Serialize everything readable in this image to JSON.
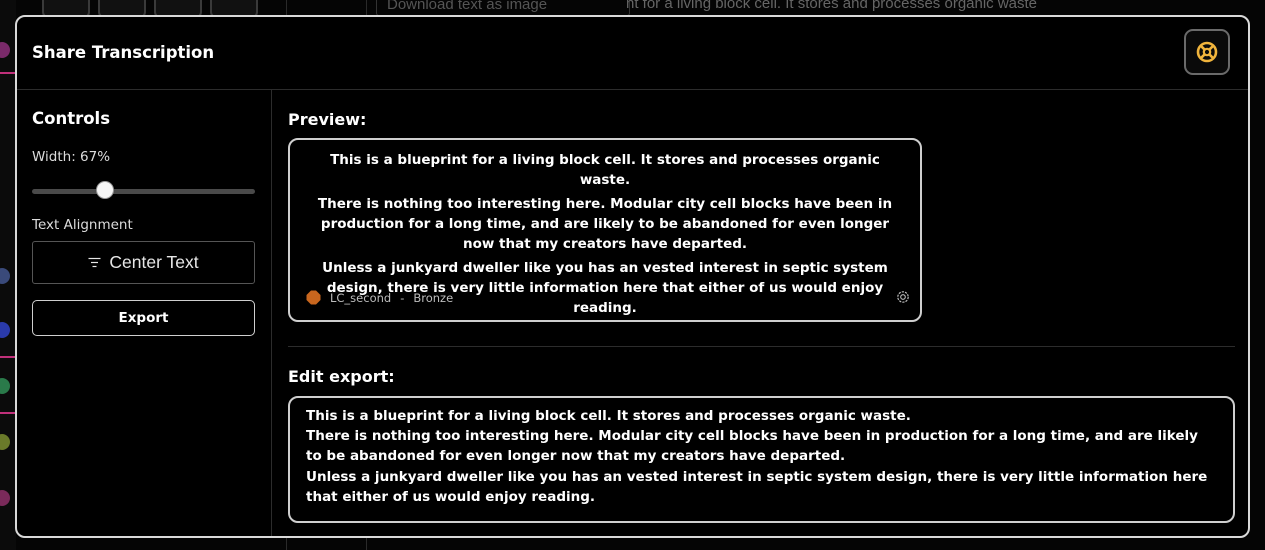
{
  "background": {
    "field_placeholder": "Download text as image",
    "text_snippet": "nt for a living block cell. It stores and processes organic waste"
  },
  "modal": {
    "title": "Share Transcription",
    "close_icon": "close-ring-icon",
    "accent_color": "#f0b43c"
  },
  "controls": {
    "title": "Controls",
    "width_label": "Width: 67%",
    "width_value": 67,
    "alignment_label": "Text Alignment",
    "alignment_button": "Center Text",
    "alignment_icon": "align-center-icon",
    "export_button": "Export"
  },
  "preview": {
    "heading": "Preview:",
    "paragraphs": [
      "This is a blueprint for a living block cell. It stores and processes organic waste.",
      "There is nothing too interesting here. Modular city cell blocks have been in production for a long time, and are likely to be abandoned for even longer now that my creators have departed.",
      "Unless a junkyard dweller like you has an vested interest in septic system design, there is very little information here that either of us would enjoy reading."
    ],
    "author": "LC_second",
    "separator": "-",
    "rank": "Bronze",
    "rank_color": "#c8661e",
    "settings_icon": "settings-icon"
  },
  "edit": {
    "heading": "Edit export:",
    "lines": [
      "This is a blueprint for a living block cell. It stores and processes organic waste.",
      "There is nothing too interesting here. Modular city cell blocks have been in production for a long time, and are likely to be abandoned for even longer now that my creators have departed.",
      "Unless a junkyard dweller like you has an vested interest in septic system design, there is very little information here that either of us would enjoy reading."
    ]
  }
}
